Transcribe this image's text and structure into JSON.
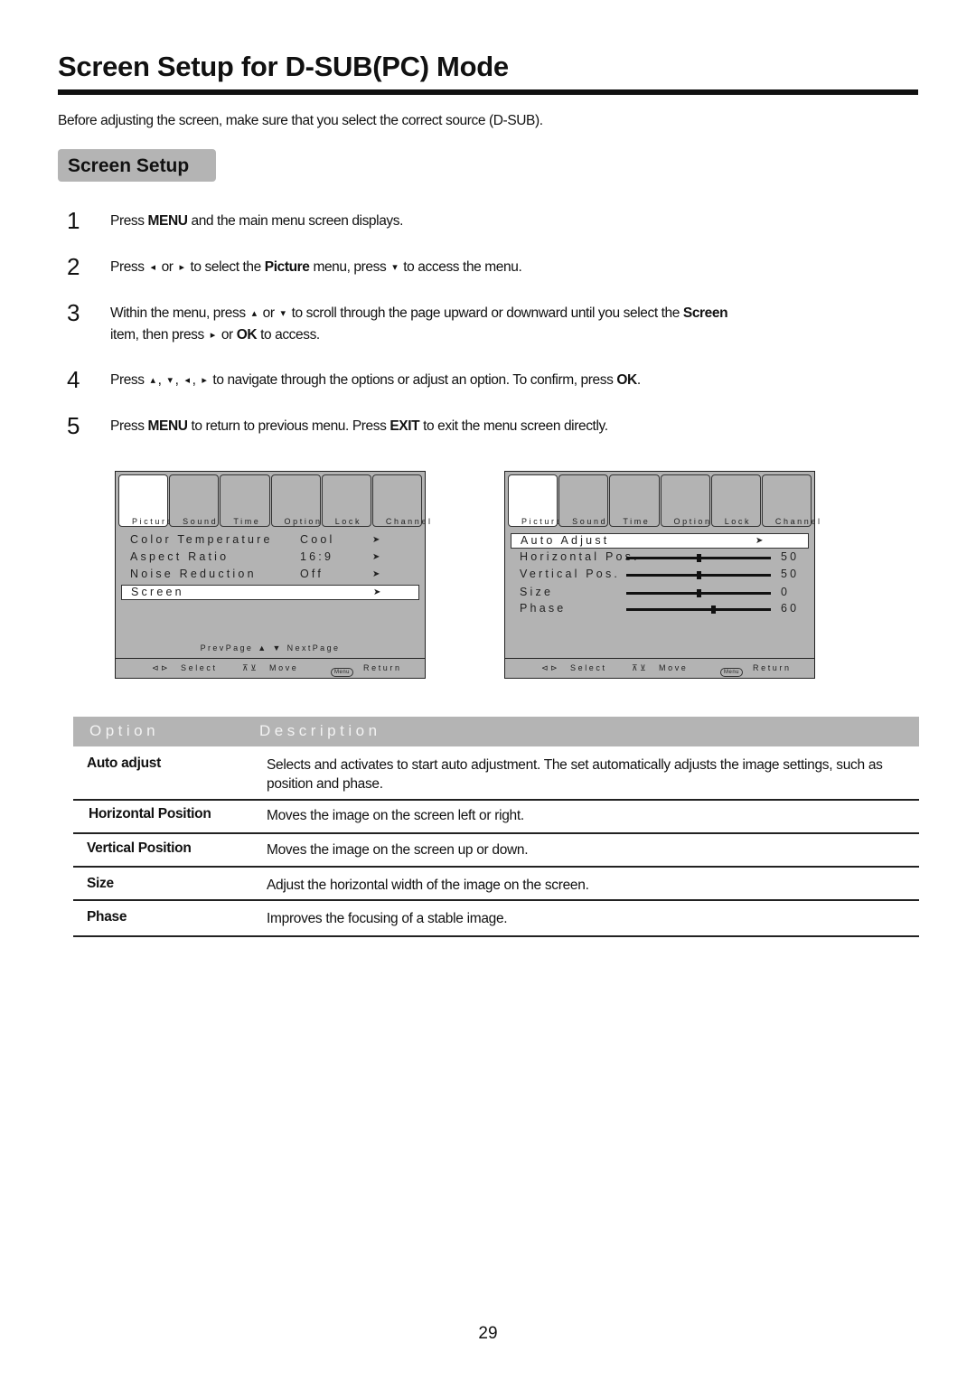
{
  "page": {
    "title": "Screen Setup for D-SUB(PC) Mode",
    "intro": "Before adjusting the screen, make sure that you select the correct source (D-SUB).",
    "section_title": "Screen Setup",
    "page_number": "29"
  },
  "steps": [
    {
      "num": "1",
      "parts": [
        {
          "t": "Press "
        },
        {
          "b": "MENU"
        },
        {
          "t": " and the main menu screen displays."
        }
      ]
    },
    {
      "num": "2",
      "parts": [
        {
          "t": "Press "
        },
        {
          "g": "◂"
        },
        {
          "t": " or "
        },
        {
          "g": "▸"
        },
        {
          "t": " to select the  "
        },
        {
          "b": "Picture"
        },
        {
          "t": " menu,  press "
        },
        {
          "g": "▾"
        },
        {
          "t": " to access the menu."
        }
      ]
    },
    {
      "num": "3",
      "parts": [
        {
          "t": "Within the menu, press "
        },
        {
          "g": "▴"
        },
        {
          "t": " or "
        },
        {
          "g": "▾"
        },
        {
          "t": " to scroll through the page upward or downward until you select the "
        },
        {
          "b": "Screen"
        }
      ],
      "line2": [
        {
          "t": "item, then press "
        },
        {
          "g": "▸"
        },
        {
          "t": " or "
        },
        {
          "b": "OK"
        },
        {
          "t": " to access."
        }
      ]
    },
    {
      "num": "4",
      "parts": [
        {
          "t": "Press "
        },
        {
          "g": "▴"
        },
        {
          "t": ", "
        },
        {
          "g": "▾"
        },
        {
          "t": ", "
        },
        {
          "g": "◂"
        },
        {
          "t": ", "
        },
        {
          "g": "▸"
        },
        {
          "t": " to navigate through the options or adjust an option. To confirm, press "
        },
        {
          "b": "OK"
        },
        {
          "t": "."
        }
      ]
    },
    {
      "num": "5",
      "parts": [
        {
          "t": "Press "
        },
        {
          "b": "MENU"
        },
        {
          "t": " to return to previous menu. Press "
        },
        {
          "b": "EXIT"
        },
        {
          "t": " to exit the menu screen directly."
        }
      ]
    }
  ],
  "osd_tabs": [
    "Picture",
    "Sound",
    "Time",
    "Option",
    "Lock",
    "Channel"
  ],
  "osd_footer": {
    "select": "Select",
    "move": "Move",
    "menu_key": "Menu",
    "return": "Return"
  },
  "osd_left": {
    "active_tab": "Picture",
    "rows": [
      {
        "label": "Color Temperature",
        "value": "Cool",
        "selected": false
      },
      {
        "label": "Aspect Ratio",
        "value": "16:9",
        "selected": false
      },
      {
        "label": "Noise Reduction",
        "value": "Off",
        "selected": false
      },
      {
        "label": "Screen",
        "value": "",
        "selected": true
      }
    ],
    "pager": {
      "prev": "PrevPage",
      "next": "NextPage"
    }
  },
  "osd_right": {
    "active_tab": "Picture",
    "auto_adjust": "Auto Adjust",
    "sliders": [
      {
        "label": "Horizontal Pos.",
        "value": "50",
        "fill": 0.5
      },
      {
        "label": "Vertical Pos.",
        "value": "50",
        "fill": 0.5
      },
      {
        "label": "Size",
        "value": "0",
        "fill": 0.5
      },
      {
        "label": "Phase",
        "value": "60",
        "fill": 0.6
      }
    ]
  },
  "table": {
    "headers": {
      "option": "Option",
      "description": "Description"
    },
    "rows": [
      {
        "option": "Auto adjust",
        "description": "Selects and activates to start auto adjustment. The set automatically adjusts the image settings, such as position and phase."
      },
      {
        "option": "Horizontal Position",
        "description": "Moves the image on the screen left or right."
      },
      {
        "option": "Vertical Position",
        "description": "Moves the image on the screen up or down."
      },
      {
        "option": "Size",
        "description": "Adjust the horizontal width of the image on the screen."
      },
      {
        "option": "Phase",
        "description": "Improves the focusing of a stable image."
      }
    ]
  },
  "colors": {
    "badge_bg": "#b4b4b4",
    "osd_bg": "#b3b3b3",
    "table_header_bg": "#b4b4b4"
  }
}
